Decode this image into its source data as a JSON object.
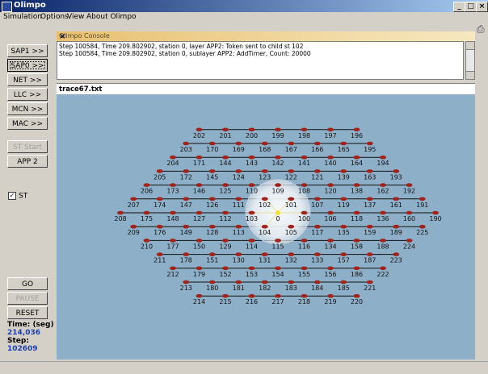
{
  "window": {
    "title": "Olimpo",
    "min_label": "_",
    "max_label": "□",
    "close_label": "×"
  },
  "menu": [
    "Simulation",
    "Options",
    "View",
    "About Olimpo"
  ],
  "left_buttons": [
    {
      "label": "SAP1 >>"
    },
    {
      "label": "SAP0 >>"
    },
    {
      "label": "NET >>"
    },
    {
      "label": "LLC >>"
    },
    {
      "label": "MCN >>"
    },
    {
      "label": "MAC >>"
    }
  ],
  "st_start_label": "ST Start",
  "app2_label": "APP 2",
  "st_checkbox": {
    "label": "ST",
    "checked": true,
    "mark": "✓"
  },
  "control_buttons": {
    "go": "GO",
    "pause": "PAUSE",
    "reset": "RESET"
  },
  "time": {
    "label": "Time: (seg)",
    "value": "214,036"
  },
  "step": {
    "label": "Step:",
    "value": "102609"
  },
  "console": {
    "title": "Olimpo Console",
    "close": "×",
    "lines": [
      "Step 100584, Time 209.802902, station 0, layer APP2: Token sent to child st 102",
      "Step 100584, Time 209.802902, station 0, sublayer APP2: AddTimer, Count: 20000"
    ]
  },
  "trace_file": "trace67.txt",
  "colors": {
    "canvas_bg": "#8eafc8",
    "node": "#a0231c",
    "edge": "#111111",
    "highlight": "#f2e633"
  },
  "network": {
    "center_node": "0",
    "highlighted_nodes": [
      "101",
      "102",
      "103",
      "104",
      "0",
      "100"
    ],
    "rows": [
      [
        "202",
        "201",
        "200",
        "199",
        "198",
        "197",
        "196"
      ],
      [
        "203",
        "170",
        "169",
        "168",
        "167",
        "166",
        "165",
        "195"
      ],
      [
        "204",
        "171",
        "144",
        "143",
        "142",
        "141",
        "140",
        "164",
        "194"
      ],
      [
        "205",
        "172",
        "145",
        "124",
        "123",
        "122",
        "121",
        "139",
        "163",
        "193"
      ],
      [
        "206",
        "173",
        "146",
        "125",
        "110",
        "109",
        "108",
        "120",
        "138",
        "162",
        "192"
      ],
      [
        "207",
        "174",
        "147",
        "126",
        "111",
        "102",
        "101",
        "107",
        "119",
        "137",
        "161",
        "191"
      ],
      [
        "208",
        "175",
        "148",
        "127",
        "112",
        "103",
        "0",
        "100",
        "106",
        "118",
        "136",
        "160",
        "190"
      ],
      [
        "209",
        "176",
        "149",
        "128",
        "113",
        "104",
        "105",
        "117",
        "135",
        "159",
        "189",
        "225"
      ],
      [
        "210",
        "177",
        "150",
        "129",
        "114",
        "115",
        "116",
        "134",
        "158",
        "188",
        "224"
      ],
      [
        "211",
        "178",
        "151",
        "130",
        "131",
        "132",
        "133",
        "157",
        "187",
        "223"
      ],
      [
        "212",
        "179",
        "152",
        "153",
        "154",
        "155",
        "156",
        "186",
        "222"
      ],
      [
        "213",
        "180",
        "181",
        "182",
        "183",
        "184",
        "185",
        "221"
      ],
      [
        "214",
        "215",
        "216",
        "217",
        "218",
        "219",
        "220"
      ]
    ]
  }
}
